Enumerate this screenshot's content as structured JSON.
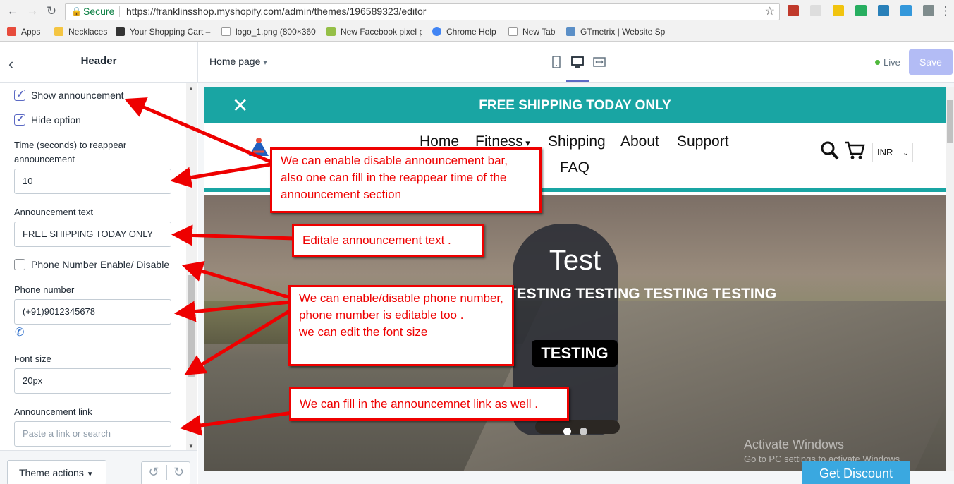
{
  "browser": {
    "secure_label": "Secure",
    "url": "https://franklinsshop.myshopify.com/admin/themes/196589323/editor",
    "bookmarks": [
      {
        "label": "Apps"
      },
      {
        "label": "Necklaces"
      },
      {
        "label": "Your Shopping Cart –"
      },
      {
        "label": "logo_1.png (800×360"
      },
      {
        "label": "New Facebook pixel p"
      },
      {
        "label": "Chrome Help"
      },
      {
        "label": "New Tab"
      },
      {
        "label": "GTmetrix | Website Sp"
      }
    ]
  },
  "editor": {
    "panel_title": "Header",
    "page_select": "Home page",
    "live_label": "Live",
    "save_label": "Save",
    "theme_actions_label": "Theme actions"
  },
  "settings": {
    "show_announcement": {
      "label": "Show announcement",
      "checked": true
    },
    "hide_option": {
      "label": "Hide option",
      "checked": true
    },
    "reappear_time": {
      "label": "Time (seconds) to reappear announcement",
      "value": "10"
    },
    "announcement_text": {
      "label": "Announcement text",
      "value": "FREE SHIPPING TODAY ONLY"
    },
    "phone_toggle": {
      "label": "Phone Number Enable/ Disable",
      "checked": false
    },
    "phone_number": {
      "label": "Phone number",
      "value": "(+91)9012345678"
    },
    "font_size": {
      "label": "Font size",
      "value": "20px"
    },
    "announcement_link": {
      "label": "Announcement link",
      "placeholder": "Paste a link or search"
    }
  },
  "preview": {
    "announcement": "FREE SHIPPING TODAY ONLY",
    "menu": {
      "home": "Home",
      "fitness": "Fitness",
      "shipping": "Shipping",
      "about": "About",
      "support": "Support",
      "faq": "FAQ"
    },
    "currency": "INR",
    "hero_title": "Test",
    "hero_subtitle": "TESTING TESTING TESTING TESTING",
    "hero_button": "TESTING",
    "get_discount": "Get Discount",
    "watermark_title": "Activate Windows",
    "watermark_sub": "Go to PC settings to activate Windows."
  },
  "callouts": {
    "announcement_bar": "We can enable disable announcement bar, also one can fill in the reappear time of the announcement section",
    "announcement_text": "Editale announcement text .",
    "phone": "We can enable/disable phone number, phone mumber is editable too .\nwe can edit the font size",
    "link": "We can fill in the announcemnet link as well ."
  },
  "colors": {
    "accent": "#19a5a3",
    "callout_red": "#e00000",
    "save_disabled": "#b3bcf5"
  }
}
